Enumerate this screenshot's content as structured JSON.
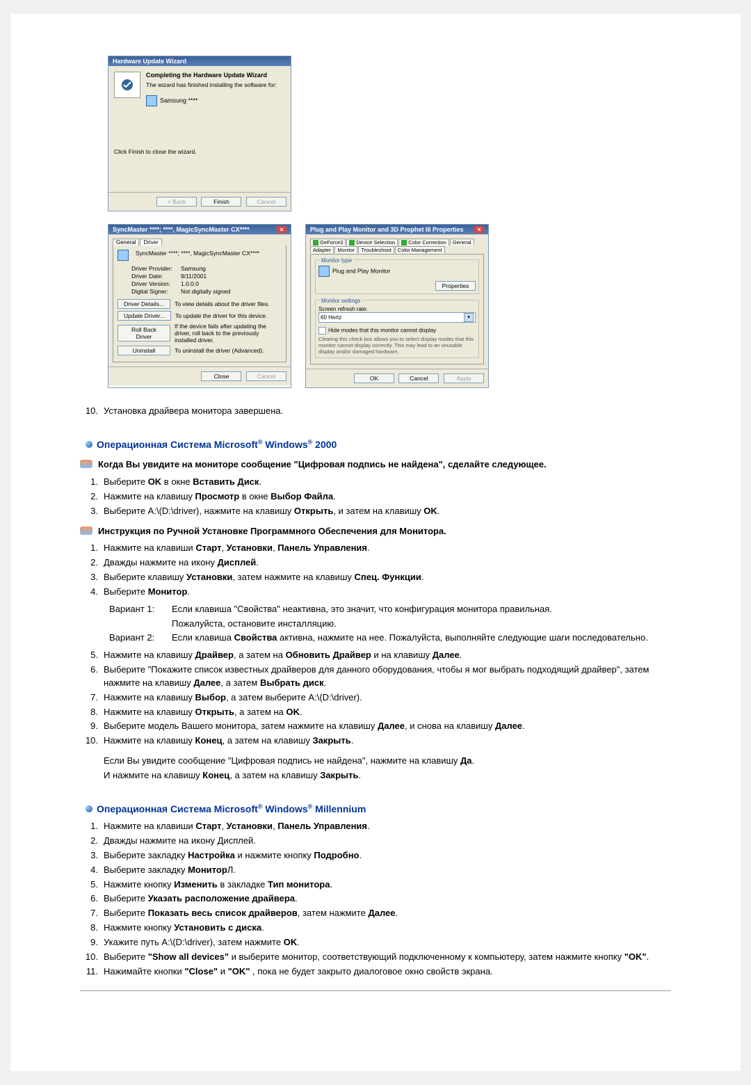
{
  "wizard1": {
    "title": "Hardware Update Wizard",
    "head": "Completing the Hardware Update Wizard",
    "sub": "The wizard has finished installing the software for:",
    "device": "Samsung ****",
    "note": "Click Finish to close the wizard.",
    "btnBack": "< Back",
    "btnFinish": "Finish",
    "btnCancel": "Cancel"
  },
  "driverDlg": {
    "title": "SyncMaster ****; ****, MagicSyncMaster CX****",
    "tabGeneral": "General",
    "tabDriver": "Driver",
    "device": "SyncMaster ****; ****, MagicSyncMaster CX****",
    "lblProvider": "Driver Provider:",
    "valProvider": "Samsung",
    "lblDate": "Driver Date:",
    "valDate": "9/11/2001",
    "lblVersion": "Driver Version:",
    "valVersion": "1.0.0.0",
    "lblSigner": "Digital Signer:",
    "valSigner": "Not digitally signed",
    "btnDetails": "Driver Details...",
    "descDetails": "To view details about the driver files.",
    "btnUpdate": "Update Driver...",
    "descUpdate": "To update the driver for this device.",
    "btnRollback": "Roll Back Driver",
    "descRollback": "If the device fails after updating the driver, roll back to the previously installed driver.",
    "btnUninstall": "Uninstall",
    "descUninstall": "To uninstall the driver (Advanced).",
    "btnClose": "Close",
    "btnCancel": "Cancel"
  },
  "propDlg": {
    "title": "Plug and Play Monitor and 3D Prophet III Properties",
    "tabs": [
      "GeForce3",
      "Device Selection",
      "Color Correction",
      "General",
      "Adapter",
      "Monitor",
      "Troubleshoot",
      "Color Management"
    ],
    "groupMonitorType": "Monitor type",
    "monitorType": "Plug and Play Monitor",
    "btnProperties": "Properties",
    "groupMonitorSettings": "Monitor settings",
    "lblRefresh": "Screen refresh rate:",
    "valRefresh": "60 Hertz",
    "hideModes": "Hide modes that this monitor cannot display",
    "hideModesDesc": "Clearing this check box allows you to select display modes that this monitor cannot display correctly. This may lead to an unusable display and/or damaged hardware.",
    "btnOK": "OK",
    "btnCancel": "Cancel",
    "btnApply": "Apply"
  },
  "doc": {
    "step10": "Установка драйвера монитора завершена.",
    "os2000_title_pre": "Операционная Система Microsoft",
    "os2000_title_mid": " Windows",
    "os2000_title_post": " 2000",
    "os2000_sub1": "Когда Вы увидите на мониторе сообщение \"Цифровая подпись не найдена\", сделайте следующее.",
    "os2000_s1_items": [
      {
        "p": "Выберите ",
        "b1": "OK",
        "m": " в окне ",
        "b2": "Вставить Диск",
        "e": "."
      },
      {
        "p": "Нажмите на клавишу ",
        "b1": "Просмотр",
        "m": " в окне ",
        "b2": "Выбор Файла",
        "e": "."
      },
      {
        "p": "Выберите A:\\(D:\\driver), нажмите на клавишу ",
        "b1": "Открыть",
        "m": ", и затем на клавишу ",
        "b2": "OK",
        "e": "."
      }
    ],
    "os2000_sub2": "Инструкция по Ручной Установке Программного Обеспечения для Монитора.",
    "os2000_s2": {
      "i1": {
        "p": "Нажмите на клавиши ",
        "b": "Старт",
        "m1": ", ",
        "b2": "Установки",
        "m2": ", ",
        "b3": "Панель Управления",
        "e": "."
      },
      "i2": {
        "p": "Дважды нажмите на икону ",
        "b": "Дисплей",
        "e": "."
      },
      "i3": {
        "p": "Выберите клавишу ",
        "b": "Установки",
        "m": ", затем нажмите на клавишу ",
        "b2": "Спец. Функции",
        "e": "."
      },
      "i4": {
        "p": "Выберите ",
        "b": "Монитор",
        "e": "."
      },
      "v1_label": "Вариант 1:",
      "v1_text1": "Если клавиша \"Свойства\" неактивна, это значит, что конфигурация монитора правильная.",
      "v1_text2": "Пожалуйста, остановите инсталляцию.",
      "v2_label": "Вариант 2:",
      "v2_p": "Если клавиша ",
      "v2_b": "Свойства",
      "v2_e": " активна, нажмите на нее. Пожалуйста, выполняйте следующие шаги последовательно.",
      "i5": {
        "p": "Нажмите на клавишу ",
        "b": "Драйвер",
        "m1": ", а затем на ",
        "b2": "Обновить Драйвер",
        "m2": " и на клавишу ",
        "b3": "Далее",
        "e": "."
      },
      "i6": {
        "p": "Выберите \"Покажите список известных драйверов для данного оборудования, чтобы я мог выбрать подходящий драйвер\", затем нажмите на клавишу ",
        "b": "Далее",
        "m": ", а затем ",
        "b2": "Выбрать диск",
        "e": "."
      },
      "i7": {
        "p": "Нажмите на клавишу ",
        "b": "Выбор",
        "m": ", а затем выберите A:\\(D:\\driver).",
        "b2": "",
        "e": ""
      },
      "i8": {
        "p": "Нажмите на клавишу ",
        "b": "Открыть",
        "m": ", а затем на ",
        "b2": "OK",
        "e": "."
      },
      "i9": {
        "p": "Выберите модель Вашего монитора, затем нажмите на клавишу ",
        "b": "Далее",
        "m": ", и снова на клавишу ",
        "b2": "Далее",
        "e": "."
      },
      "i10": {
        "p": "Нажмите на клавишу ",
        "b": "Конец",
        "m": ", а затем на клавишу ",
        "b2": "Закрыть",
        "e": "."
      },
      "note1_p": "Если Вы увидите сообщение \"Цифровая подпись не найдена\", нажмите на клавишу ",
      "note1_b": "Да",
      "note1_e": ".",
      "note2_p": "И нажмите на клавишу ",
      "note2_b": "Конец",
      "note2_m": ", а затем на клавишу ",
      "note2_b2": "Закрыть",
      "note2_e": "."
    },
    "osME_title_pre": "Операционная Система Microsoft",
    "osME_title_mid": " Windows",
    "osME_title_post": " Millennium",
    "osME": {
      "i1": {
        "p": "Нажмите на клавиши ",
        "b": "Старт",
        "m1": ", ",
        "b2": "Установки",
        "m2": ", ",
        "b3": "Панель Управления",
        "e": "."
      },
      "i2": "Дважды нажмите на икону Дисплей.",
      "i3": {
        "p": "Выберите закладку ",
        "b": "Настройка",
        "m": " и нажмите кнопку ",
        "b2": "Подробно",
        "e": "."
      },
      "i4": {
        "p": "Выберите закладку ",
        "b": "Монитор",
        "e": "Л."
      },
      "i5": {
        "p": "Нажмите кнопку ",
        "b": "Изменить",
        "m": " в закладке ",
        "b2": "Тип монитора",
        "e": "."
      },
      "i6": {
        "p": "Выберите ",
        "b": "Указать расположение драйвера",
        "e": "."
      },
      "i7": {
        "p": "Выберите ",
        "b": "Показать весь список драйверов",
        "m": ", затем нажмите ",
        "b2": "Далее",
        "e": "."
      },
      "i8": {
        "p": "Нажмите кнопку ",
        "b": "Установить с диска",
        "e": "."
      },
      "i9": {
        "p": "Укажите путь A:\\(D:\\driver), затем нажмите ",
        "b": "OK",
        "e": "."
      },
      "i10": {
        "p": "Выберите ",
        "b": "\"Show all devices\"",
        "m": " и выберите монитор, соответствующий подключенному к компьютеру, затем нажмите кнопку ",
        "b2": "\"OK\"",
        "e": "."
      },
      "i11": {
        "p": "Нажимайте кнопки ",
        "b": "\"Close\"",
        "m": " и ",
        "b2": "\"OK\"",
        "e": " , пока не будет закрыто диалоговое окно свойств экрана."
      }
    }
  }
}
